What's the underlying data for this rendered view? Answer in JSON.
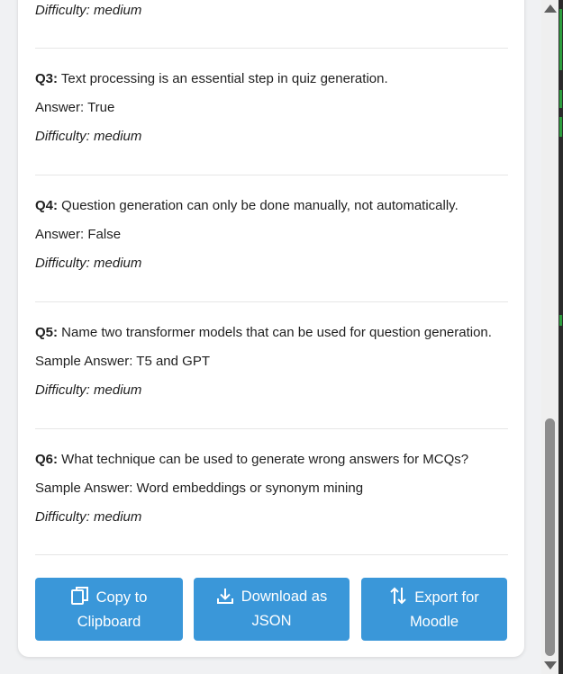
{
  "questions": [
    {
      "difficulty": "Difficulty: medium"
    },
    {
      "num": "Q3:",
      "text": " Text processing is an essential step in quiz generation.",
      "answer": "Answer: True",
      "difficulty": "Difficulty: medium"
    },
    {
      "num": "Q4:",
      "text": " Question generation can only be done manually, not automatically.",
      "answer": "Answer: False",
      "difficulty": "Difficulty: medium"
    },
    {
      "num": "Q5:",
      "text": " Name two transformer models that can be used for question generation.",
      "answer": "Sample Answer: T5 and GPT",
      "difficulty": "Difficulty: medium"
    },
    {
      "num": "Q6:",
      "text": " What technique can be used to generate wrong answers for MCQs?",
      "answer": "Sample Answer: Word embeddings or synonym mining",
      "difficulty": "Difficulty: medium"
    }
  ],
  "buttons": {
    "copy": {
      "line1": "Copy to",
      "line2": "Clipboard",
      "icon": "copy-icon"
    },
    "download": {
      "line1": "Download as",
      "line2": "JSON",
      "icon": "download-icon"
    },
    "export": {
      "line1": "Export for",
      "line2": "Moodle",
      "icon": "export-arrows-icon"
    }
  },
  "colors": {
    "button": "#3a97d9",
    "card": "#ffffff",
    "text": "#1f1f1f"
  }
}
